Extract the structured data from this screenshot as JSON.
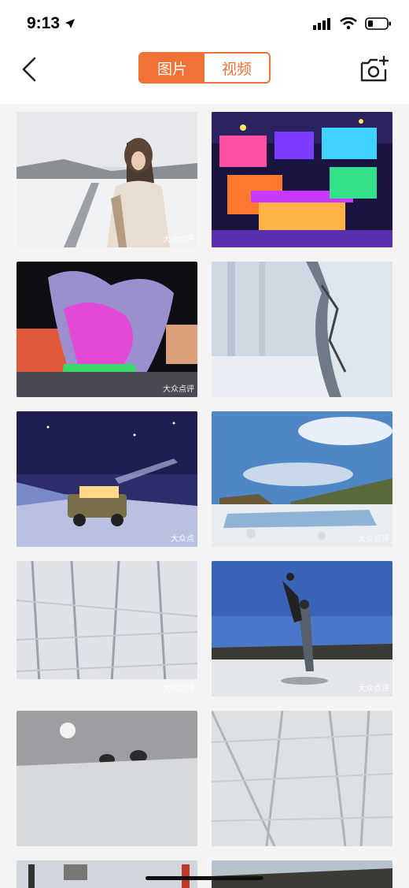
{
  "status": {
    "time": "9:13"
  },
  "nav": {
    "tabs": [
      {
        "label": "图片",
        "active": true
      },
      {
        "label": "视频",
        "active": false
      }
    ]
  },
  "photos": [
    {
      "desc_icon": "person-on-snowy-railway",
      "watermark": "大众点评"
    },
    {
      "desc_icon": "ice-village-lights",
      "watermark": ""
    },
    {
      "desc_icon": "ice-sculpture-night",
      "watermark": "大众点评"
    },
    {
      "desc_icon": "frosted-tree-closeup",
      "watermark": ""
    },
    {
      "desc_icon": "car-under-starry-sky",
      "watermark": "大众点"
    },
    {
      "desc_icon": "snowy-river-landscape",
      "watermark": "大众点评"
    },
    {
      "desc_icon": "frosted-forest",
      "watermark": "大众点评"
    },
    {
      "desc_icon": "couple-acrobatic-pose",
      "watermark": "大众点评"
    },
    {
      "desc_icon": "snowfield-sun-trees",
      "watermark": ""
    },
    {
      "desc_icon": "frosted-branches",
      "watermark": ""
    }
  ],
  "colors": {
    "accent": "#f27135"
  }
}
